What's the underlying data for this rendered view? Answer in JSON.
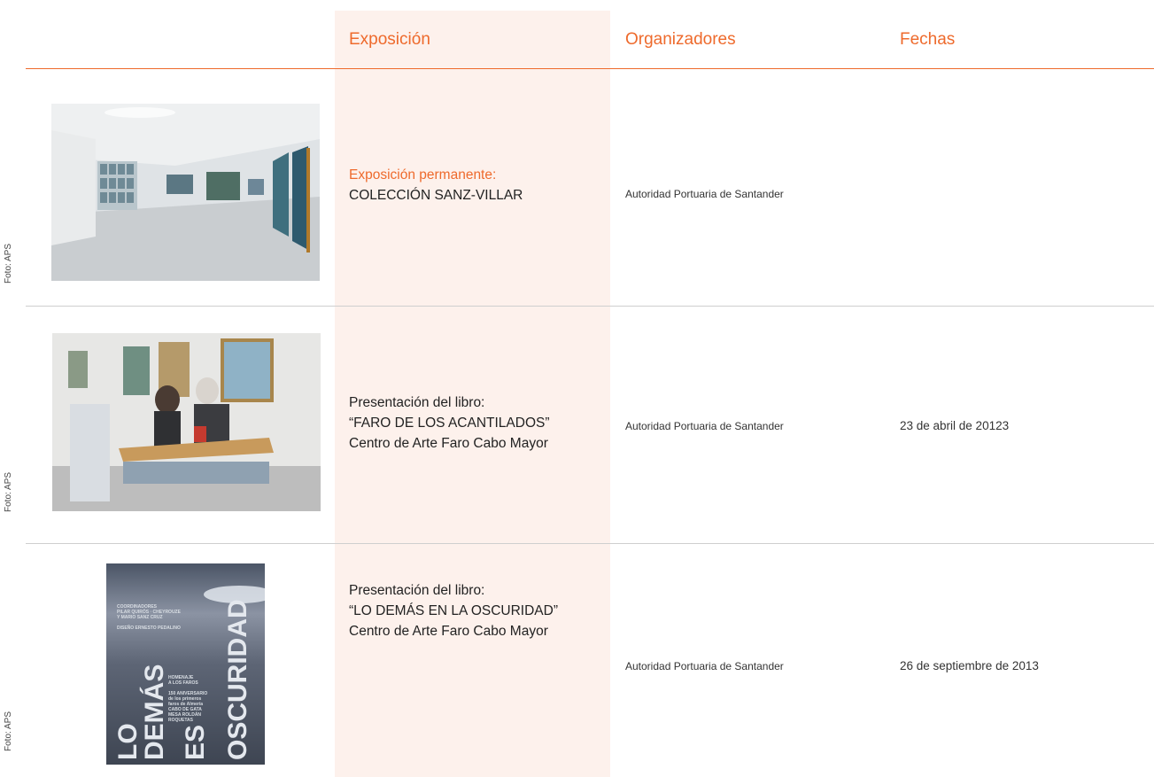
{
  "headers": {
    "exposicion": "Exposición",
    "organizadores": "Organizadores",
    "fechas": "Fechas"
  },
  "rows": [
    {
      "credit": "Foto: APS",
      "title_accent": "Exposición permanente:",
      "title_lines": [
        "COLECCIÓN SANZ-VILLAR"
      ],
      "organizer": "Autoridad Portuaria de Santander",
      "date": ""
    },
    {
      "credit": "Foto: APS",
      "title_accent": "",
      "title_lines": [
        "Presentación del libro:",
        " “FARO DE LOS ACANTILADOS”",
        "Centro de Arte Faro  Cabo Mayor"
      ],
      "organizer": "Autoridad Portuaria de Santander",
      "date": "23 de abril de 20123"
    },
    {
      "credit": "Foto: APS",
      "title_accent": "",
      "title_lines": [
        "Presentación del libro:",
        "“LO DEMÁS EN LA OSCURIDAD”",
        "Centro de Arte Faro  Cabo Mayor"
      ],
      "organizer": "Autoridad Portuaria de Santander",
      "date": "26 de septiembre de 2013"
    }
  ],
  "cover": {
    "title_words": [
      "LO",
      "DEMÁS",
      "ES",
      "OSCURIDAD"
    ],
    "credits_lines": [
      "COORDINADORES",
      "PILAR QUIRÓS · CHEYROUZE",
      "Y MARIO SANZ CRUZ",
      "DISEÑO ERNESTO PEDALINO"
    ],
    "subtitle_lines": [
      "HOMENAJE",
      "A LOS FAROS",
      "150 ANIVERSARIO",
      "de los primeros",
      "faros de Almería",
      "CABO DE GATA",
      "MESA ROLDÁN",
      "ROQUETAS"
    ]
  },
  "colors": {
    "accent": "#ee6a2c",
    "column_band": "#fdf1ec",
    "rule": "#cfcfcf"
  }
}
